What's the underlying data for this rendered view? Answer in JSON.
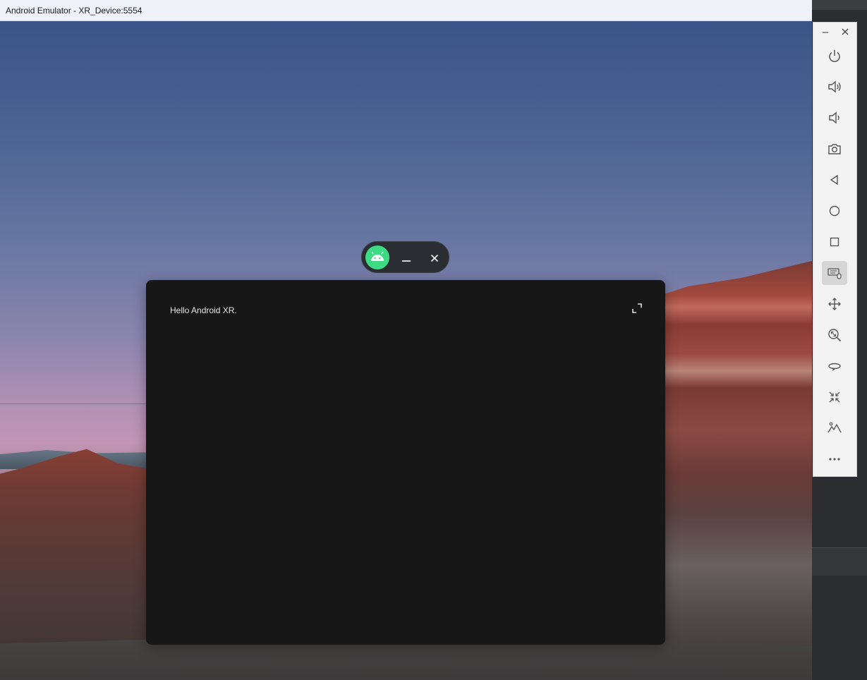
{
  "window": {
    "title": "Android Emulator - XR_Device:5554"
  },
  "app": {
    "greeting": "Hello Android XR."
  },
  "orbiter": {
    "app_icon": "android-icon",
    "minimize_icon": "minimize-icon",
    "close_icon": "close-icon"
  },
  "panel": {
    "expand_icon": "expand-icon"
  },
  "toolbar": {
    "items": [
      {
        "icon": "power-icon"
      },
      {
        "icon": "volume-up-icon"
      },
      {
        "icon": "volume-down-icon"
      },
      {
        "icon": "camera-icon"
      },
      {
        "icon": "back-icon"
      },
      {
        "icon": "home-icon"
      },
      {
        "icon": "overview-icon"
      },
      {
        "icon": "keyboard-mouse-icon",
        "active": true
      },
      {
        "icon": "move-icon"
      },
      {
        "icon": "zoom-icon"
      },
      {
        "icon": "rotate-view-icon"
      },
      {
        "icon": "recenter-icon"
      },
      {
        "icon": "environment-icon"
      },
      {
        "icon": "more-icon"
      }
    ]
  },
  "colors": {
    "panel_bg": "#171717",
    "android_green": "#3ddc84",
    "orbiter_bg": "#2a2d31",
    "toolbar_bg": "#f3f3f3"
  }
}
